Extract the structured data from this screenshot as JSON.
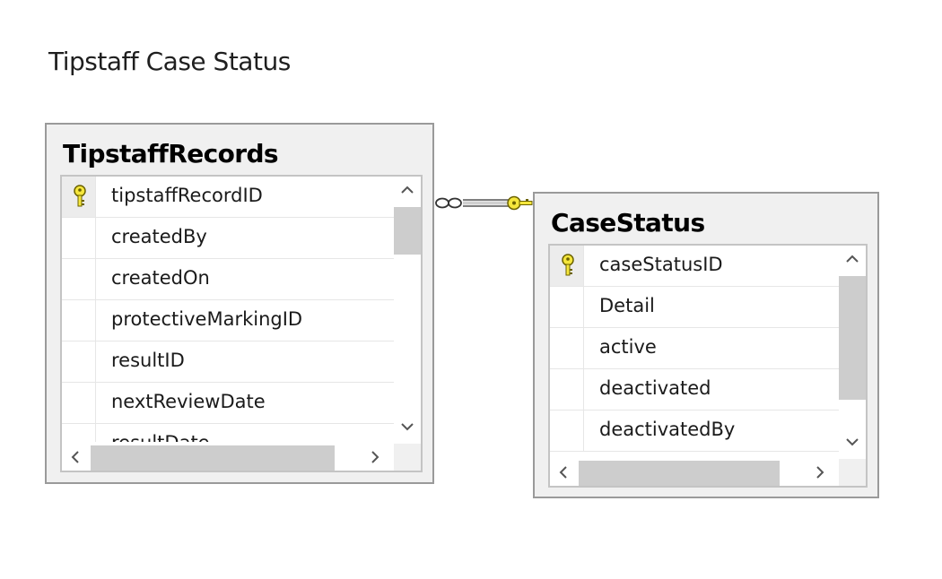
{
  "diagram": {
    "title": "Tipstaff Case Status"
  },
  "tables": [
    {
      "name": "TipstaffRecords",
      "columns": [
        {
          "label": "tipstaffRecordID",
          "primary_key": true
        },
        {
          "label": "createdBy",
          "primary_key": false
        },
        {
          "label": "createdOn",
          "primary_key": false
        },
        {
          "label": "protectiveMarkingID",
          "primary_key": false
        },
        {
          "label": "resultID",
          "primary_key": false
        },
        {
          "label": "nextReviewDate",
          "primary_key": false
        },
        {
          "label": "resultDate",
          "primary_key": false
        }
      ]
    },
    {
      "name": "CaseStatus",
      "columns": [
        {
          "label": "caseStatusID",
          "primary_key": true
        },
        {
          "label": "Detail",
          "primary_key": false
        },
        {
          "label": "active",
          "primary_key": false
        },
        {
          "label": "deactivated",
          "primary_key": false
        },
        {
          "label": "deactivatedBy",
          "primary_key": false
        }
      ]
    }
  ],
  "relationship": {
    "from_table": "TipstaffRecords",
    "to_table": "CaseStatus",
    "from_end": "many",
    "to_end": "one"
  },
  "icons": {
    "primary_key": "key-icon",
    "scroll_up": "chevron-up-icon",
    "scroll_down": "chevron-down-icon",
    "scroll_left": "chevron-left-icon",
    "scroll_right": "chevron-right-icon"
  },
  "colors": {
    "key_fill": "#f5e63c",
    "key_outline": "#6b6200",
    "table_background": "#f0f0f0",
    "table_border": "#9a9a9a",
    "scroll_thumb": "#cdcdcd"
  }
}
